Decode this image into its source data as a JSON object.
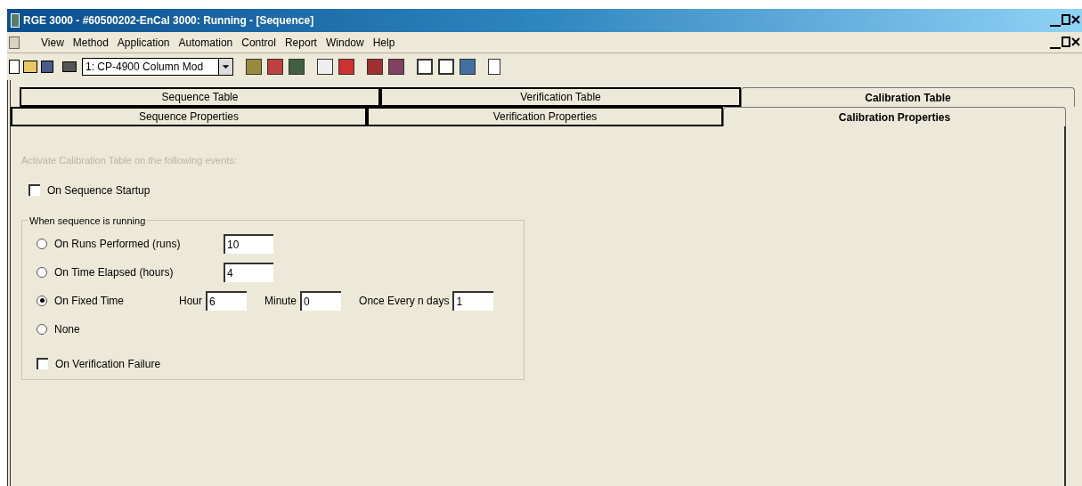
{
  "window": {
    "title": "RGE 3000 - #60500202-EnCal 3000: Running - [Sequence]"
  },
  "menu": [
    "View",
    "Method",
    "Application",
    "Automation",
    "Control",
    "Report",
    "Window",
    "Help"
  ],
  "toolbar": {
    "method_select": "1: CP-4900 Column Mod"
  },
  "tabs_top": [
    {
      "label": "Sequence Table",
      "selected": false
    },
    {
      "label": "Verification Table",
      "selected": false
    },
    {
      "label": "Calibration Table",
      "selected": true
    }
  ],
  "tabs_bottom": [
    {
      "label": "Sequence Properties",
      "selected": false
    },
    {
      "label": "Verification Properties",
      "selected": false
    },
    {
      "label": "Calibration Properties",
      "selected": true
    }
  ],
  "intro": "Activate Calibration Table on the following events:",
  "startup": {
    "label": "On Sequence Startup",
    "checked": false
  },
  "group": {
    "title": "When sequence is running",
    "options": [
      {
        "label": "On Runs Performed (runs)",
        "selected": false,
        "fields": [
          {
            "value": "10"
          }
        ]
      },
      {
        "label": "On Time Elapsed (hours)",
        "selected": false,
        "fields": [
          {
            "value": "4"
          }
        ]
      },
      {
        "label": "On Fixed Time",
        "selected": true,
        "fields": [
          {
            "label": "Hour",
            "value": "6"
          },
          {
            "label": "Minute",
            "value": "0"
          },
          {
            "label": "Once Every n days",
            "value": "1"
          }
        ]
      },
      {
        "label": "None",
        "selected": false
      }
    ],
    "failure": {
      "label": "On Verification Failure",
      "checked": false
    }
  }
}
